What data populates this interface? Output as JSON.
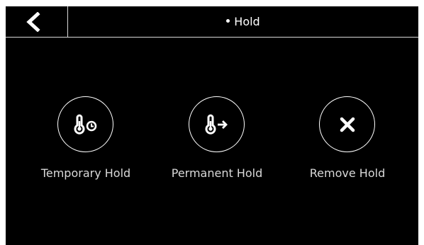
{
  "header": {
    "title": "Hold",
    "back_icon": "chevron-left-icon"
  },
  "actions": [
    {
      "label": "Temporary Hold",
      "icon": "thermometer-clock-icon"
    },
    {
      "label": "Permanent Hold",
      "icon": "thermometer-arrow-icon"
    },
    {
      "label": "Remove Hold",
      "icon": "close-icon"
    }
  ],
  "colors": {
    "background": "#000000",
    "foreground": "#ffffff",
    "label": "#d9d9d9",
    "divider": "#d9d9d9"
  }
}
